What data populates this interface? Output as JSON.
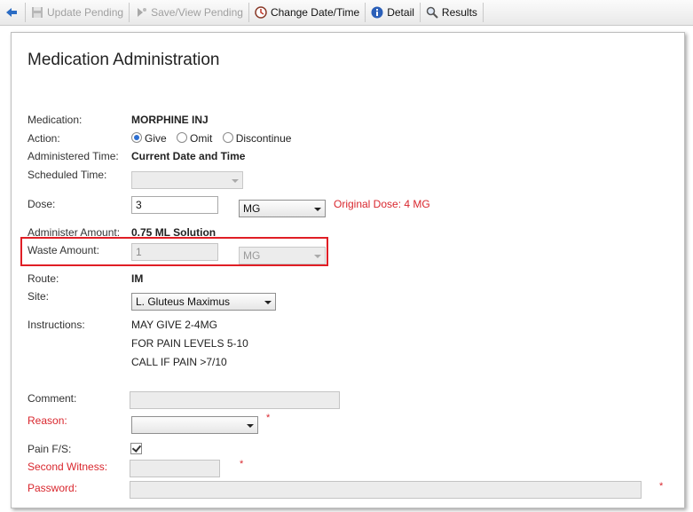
{
  "toolbar": {
    "update_pending": "Update Pending",
    "save_view_pending": "Save/View Pending",
    "change_date_time": "Change Date/Time",
    "detail": "Detail",
    "results": "Results"
  },
  "page": {
    "title": "Medication Administration"
  },
  "form": {
    "medication_label": "Medication:",
    "medication_value": "MORPHINE INJ",
    "action_label": "Action:",
    "action_options": [
      "Give",
      "Omit",
      "Discontinue"
    ],
    "action_selected": "Give",
    "administered_time_label": "Administered Time:",
    "administered_time_value": "Current Date and Time",
    "scheduled_time_label": "Scheduled Time:",
    "dose_label": "Dose:",
    "dose_value": "3",
    "dose_unit": "MG",
    "original_dose": "Original Dose: 4 MG",
    "administer_amount_label": "Administer Amount:",
    "administer_amount_value": "0.75 ML Solution",
    "waste_amount_label": "Waste Amount:",
    "waste_amount_value": "1",
    "waste_unit": "MG",
    "route_label": "Route:",
    "route_value": "IM",
    "site_label": "Site:",
    "site_value": "L. Gluteus Maximus",
    "instructions_label": "Instructions:",
    "instructions": [
      "MAY GIVE 2-4MG",
      "FOR PAIN LEVELS 5-10",
      "CALL IF PAIN >7/10"
    ],
    "comment_label": "Comment:",
    "reason_label": "Reason:",
    "pain_fs_label": "Pain F/S:",
    "pain_fs_checked": true,
    "second_witness_label": "Second Witness:",
    "password_label": "Password:",
    "required_mark": "*"
  },
  "colors": {
    "required": "#d9272e",
    "highlight": "#e01e25",
    "radio_selected": "#2d6fd1"
  }
}
